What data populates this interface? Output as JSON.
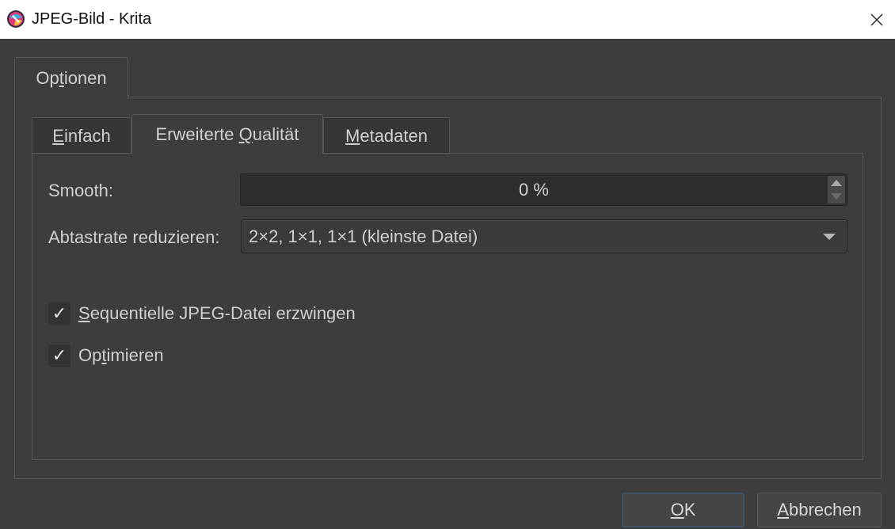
{
  "window": {
    "title": "JPEG-Bild - Krita",
    "icon": "krita-app-icon",
    "close_icon": "close-icon"
  },
  "outer_tabs": [
    {
      "label_pre": "Op",
      "label_mn": "t",
      "label_post": "ionen",
      "active": true
    }
  ],
  "inner_tabs": [
    {
      "label_pre": "",
      "label_mn": "E",
      "label_post": "infach",
      "active": false
    },
    {
      "label_pre": "Erweiterte ",
      "label_mn": "Q",
      "label_post": "ualität",
      "active": true
    },
    {
      "label_pre": "",
      "label_mn": "M",
      "label_post": "etadaten",
      "active": false
    }
  ],
  "smooth": {
    "label": "Smooth:",
    "value": "0 %"
  },
  "subsampling": {
    "label": "Abtastrate reduzieren:",
    "selected": "2×2, 1×1, 1×1 (kleinste Datei)"
  },
  "checkboxes": [
    {
      "label_pre": "",
      "label_mn": "S",
      "label_post": "equentielle JPEG-Datei erzwingen",
      "checked": true,
      "mark": "✓"
    },
    {
      "label_pre": "Op",
      "label_mn": "t",
      "label_post": "imieren",
      "checked": true,
      "mark": "✓"
    }
  ],
  "buttons": {
    "ok": {
      "label_mn": "O",
      "label_post": "K"
    },
    "cancel": {
      "label_mn": "A",
      "label_post": "bbrechen"
    }
  },
  "colors": {
    "background": "#3d3d3d",
    "titlebar": "#ffffff",
    "ok_focus_border": "#3e5366"
  }
}
